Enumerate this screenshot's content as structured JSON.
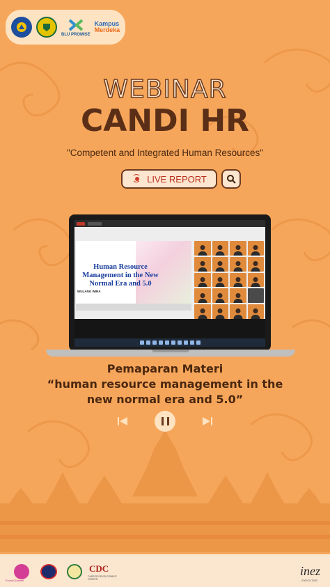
{
  "header": {
    "logos": [
      "tut-wuri-handayani-logo",
      "university-crest-logo",
      "blu-logo",
      "kampus-merdeka-logo"
    ],
    "blu_label": "BLU PROMISE",
    "kampus_label_1": "Kampus",
    "kampus_label_2": "Merdeka"
  },
  "title": {
    "webinar": "WEBINAR",
    "event": "CANDI HR",
    "tagline": "\"Competent and Integrated Human Resources\""
  },
  "live": {
    "label": "LIVE REPORT",
    "icon": "broadcast-icon",
    "search_icon": "search-icon"
  },
  "screen": {
    "slide_title": "Human Resource Management in the New Normal Era and 5.0",
    "slide_name": "WULANG WIRA"
  },
  "caption": {
    "line1": "Pemaparan Materi",
    "line2": "“human resource management in the",
    "line3": "new normal era and 5.0”"
  },
  "controls": {
    "prev_icon": "skip-previous-icon",
    "pause_icon": "pause-icon",
    "next_icon": "skip-next-icon"
  },
  "footer": {
    "logo1_caption": "EconoChannel",
    "cdc": "CDC",
    "cdc_sub": "CAREER DEVELOPMENT CENTER",
    "inez": "inez",
    "inez_sub": "EXECUTIVE"
  },
  "colors": {
    "background": "#f6a65a",
    "title_dark": "#5b2f17",
    "live_red": "#b92f1f",
    "footer_bg": "#fbe6cf"
  }
}
